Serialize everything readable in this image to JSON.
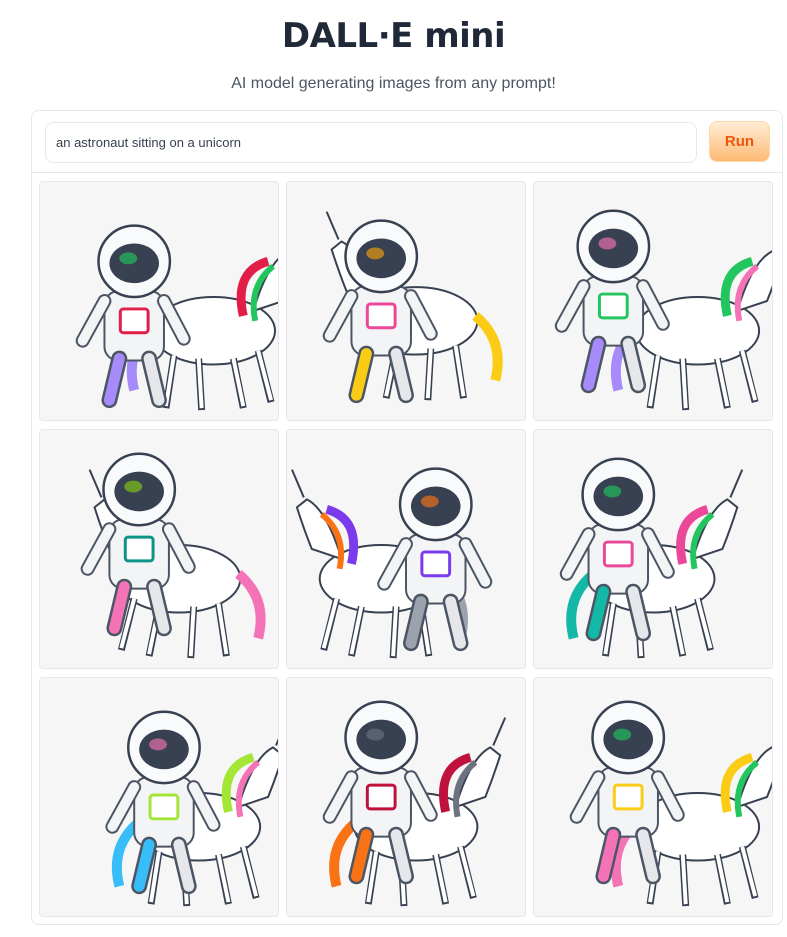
{
  "header": {
    "title": "DALL·E mini",
    "subtitle": "AI model generating images from any prompt!"
  },
  "prompt": {
    "value": "an astronaut sitting on a unicorn",
    "run_label": "Run"
  },
  "colors": {
    "accent": "#ea580c",
    "button_bg": "#fed7aa",
    "border": "#e5e7eb"
  },
  "results": {
    "count": 9,
    "images": [
      {
        "subject": "astronaut on unicorn",
        "palette": [
          "#e11d48",
          "#22c55e",
          "#a78bfa"
        ]
      },
      {
        "subject": "astronaut on unicorn",
        "palette": [
          "#ec4899",
          "#f59e0b",
          "#facc15"
        ]
      },
      {
        "subject": "astronaut on unicorn",
        "palette": [
          "#22c55e",
          "#f472b6",
          "#a78bfa"
        ]
      },
      {
        "subject": "astronaut on unicorn",
        "palette": [
          "#0d9488",
          "#84cc16",
          "#f472b6"
        ]
      },
      {
        "subject": "astronaut on unicorn",
        "palette": [
          "#7c3aed",
          "#f97316",
          "#9ca3af"
        ]
      },
      {
        "subject": "astronaut on unicorn",
        "palette": [
          "#ec4899",
          "#22c55e",
          "#14b8a6"
        ]
      },
      {
        "subject": "astronaut on unicorn",
        "palette": [
          "#a3e635",
          "#f472b6",
          "#38bdf8"
        ]
      },
      {
        "subject": "astronaut on unicorn",
        "palette": [
          "#be123c",
          "#6b7280",
          "#f97316"
        ]
      },
      {
        "subject": "astronaut on unicorn",
        "palette": [
          "#facc15",
          "#22c55e",
          "#f472b6"
        ]
      }
    ]
  }
}
